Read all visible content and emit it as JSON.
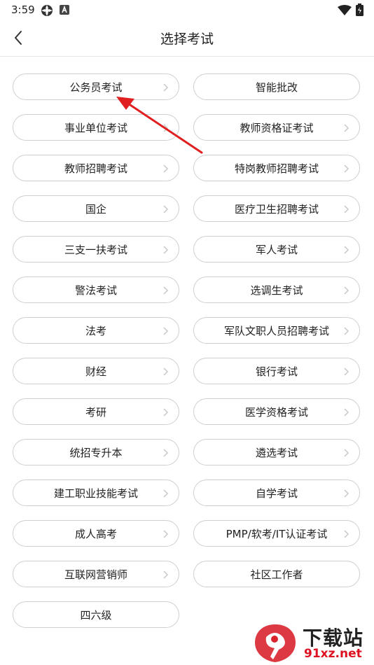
{
  "status_bar": {
    "time": "3:59"
  },
  "header": {
    "title": "选择考试",
    "back_icon": "chevron-left-icon"
  },
  "exams": [
    {
      "label": "公务员考试",
      "has_chevron": true
    },
    {
      "label": "智能批改",
      "has_chevron": false
    },
    {
      "label": "事业单位考试",
      "has_chevron": true
    },
    {
      "label": "教师资格证考试",
      "has_chevron": true
    },
    {
      "label": "教师招聘考试",
      "has_chevron": true
    },
    {
      "label": "特岗教师招聘考试",
      "has_chevron": true
    },
    {
      "label": "国企",
      "has_chevron": true
    },
    {
      "label": "医疗卫生招聘考试",
      "has_chevron": true
    },
    {
      "label": "三支一扶考试",
      "has_chevron": true
    },
    {
      "label": "军人考试",
      "has_chevron": true
    },
    {
      "label": "警法考试",
      "has_chevron": true
    },
    {
      "label": "选调生考试",
      "has_chevron": true
    },
    {
      "label": "法考",
      "has_chevron": true
    },
    {
      "label": "军队文职人员招聘考试",
      "has_chevron": true
    },
    {
      "label": "财经",
      "has_chevron": true
    },
    {
      "label": "银行考试",
      "has_chevron": true
    },
    {
      "label": "考研",
      "has_chevron": true
    },
    {
      "label": "医学资格考试",
      "has_chevron": true
    },
    {
      "label": "统招专升本",
      "has_chevron": true
    },
    {
      "label": "遴选考试",
      "has_chevron": true
    },
    {
      "label": "建工职业技能考试",
      "has_chevron": true
    },
    {
      "label": "自学考试",
      "has_chevron": true
    },
    {
      "label": "成人高考",
      "has_chevron": true
    },
    {
      "label": "PMP/软考/IT认证考试",
      "has_chevron": true
    },
    {
      "label": "互联网营销师",
      "has_chevron": true
    },
    {
      "label": "社区工作者",
      "has_chevron": false
    },
    {
      "label": "四六级",
      "has_chevron": false
    }
  ],
  "annotation": {
    "color": "#e02020",
    "points_to": "公务员考试"
  },
  "watermark": {
    "text": "下载站",
    "url": "91xz.net",
    "logo_color": "#d9232d"
  }
}
